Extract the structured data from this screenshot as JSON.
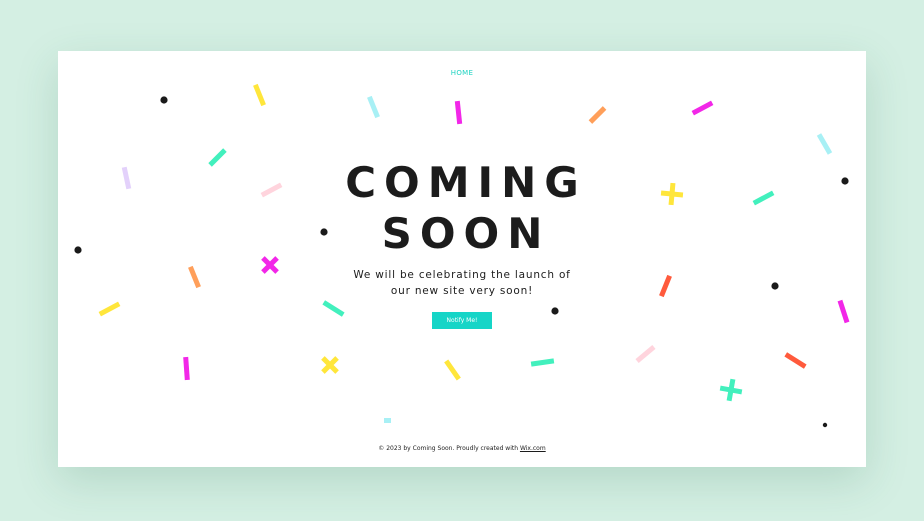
{
  "nav": {
    "home_label": "HOME"
  },
  "hero": {
    "title_line1": "COMING",
    "title_line2": "SOON",
    "subtitle_line1": "We will be celebrating the launch of",
    "subtitle_line2": "our new site very soon!",
    "button_label": "Notify Me!"
  },
  "footer": {
    "text": "© 2023 by Coming Soon. Proudly created with ",
    "link_label": "Wix.com"
  },
  "colors": {
    "background": "#d4efe3",
    "accent": "#16d5c7",
    "text": "#1c1c1c",
    "confetti_yellow": "#ffe63b",
    "confetti_magenta": "#f227e8",
    "confetti_mint": "#42f0bd",
    "confetti_sky": "#a8f0f5",
    "confetti_orange": "#ff9f5a",
    "confetti_pink": "#ffd4dd",
    "confetti_lavender": "#e3d1fb",
    "confetti_red": "#ff5a3c",
    "dot": "#1a1a1a"
  }
}
